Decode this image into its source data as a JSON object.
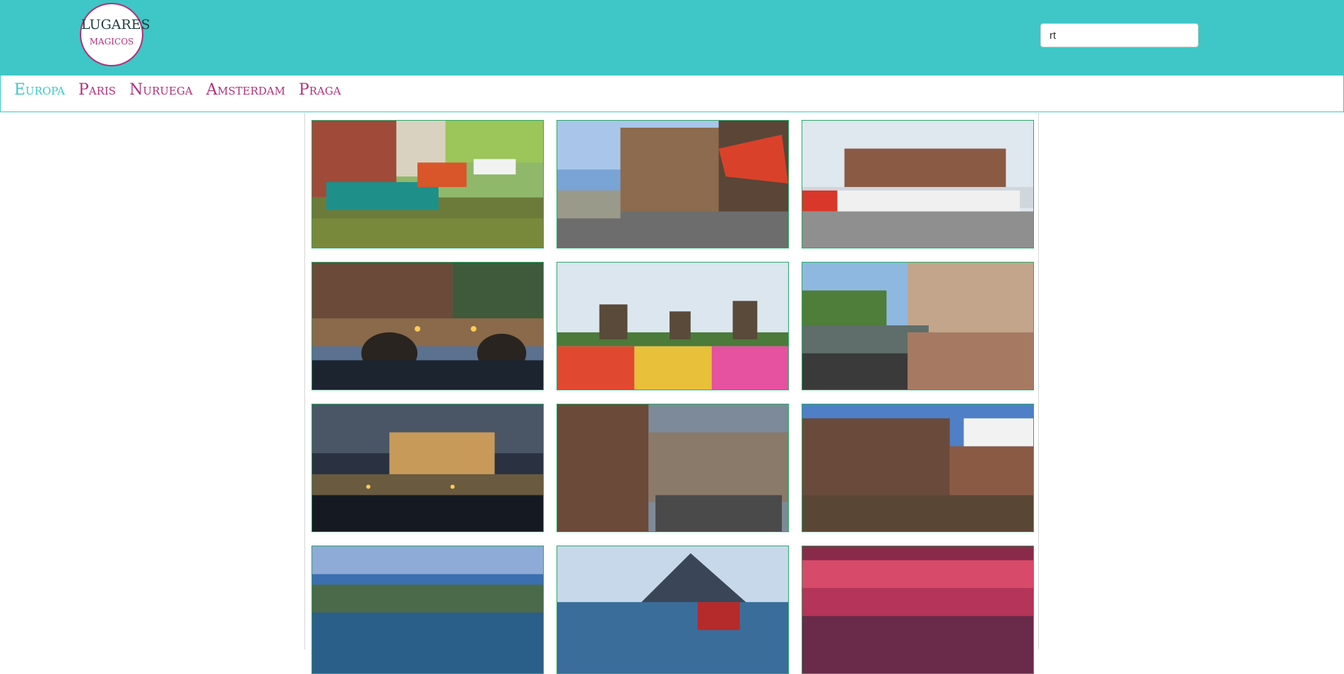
{
  "logo": {
    "title": "LUGARES",
    "subtitle": "MAGICOS"
  },
  "search": {
    "value": "rt"
  },
  "nav": {
    "items": [
      "Europa",
      "Paris",
      "Nuruega",
      "Amsterdam",
      "Praga"
    ]
  },
  "colors": {
    "header": "#3fc6c6",
    "accent": "#b0307a",
    "tile_border": "#2ea86a"
  },
  "gallery": {
    "images": [
      "canal-houseboats-photo",
      "street-cafe-photo",
      "iamsterdam-sign-photo",
      "bridge-night-photo",
      "windmills-tulips-photo",
      "canal-bicycles-photo",
      "canal-houses-night-photo",
      "brick-alley-photo",
      "canal-houses-photo",
      "fjord-coast-photo",
      "mountain-red-house-photo",
      "sunset-sky-photo"
    ]
  }
}
